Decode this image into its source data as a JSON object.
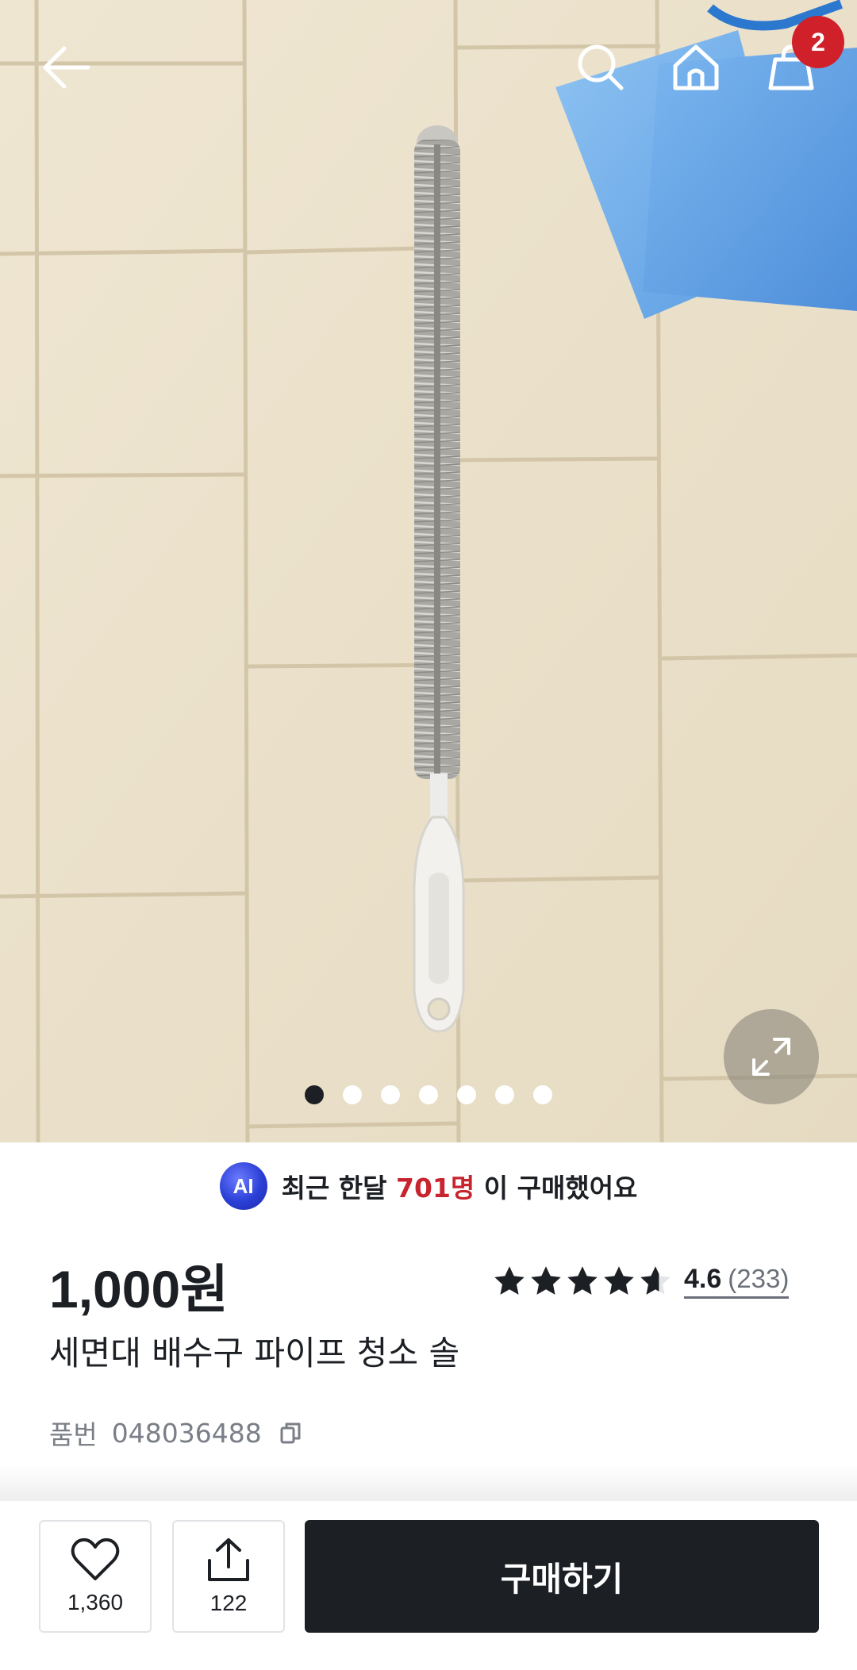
{
  "header": {
    "cart_badge": "2"
  },
  "hero": {
    "image_count": 7,
    "active_index": 0
  },
  "ai_summary": {
    "badge": "AI",
    "prefix": "최근 한달",
    "highlight": "701명",
    "suffix": "이 구매했어요"
  },
  "product": {
    "price": "1,000원",
    "title": "세면대 배수구 파이프 청소 솔",
    "sku_label": "품번",
    "sku": "048036488"
  },
  "rating": {
    "score": "4.6",
    "count": "(233)",
    "value": 4.6,
    "max": 5
  },
  "bottom_bar": {
    "like_count": "1,360",
    "share_count": "122",
    "buy_label": "구매하기"
  },
  "colors": {
    "accent": "#c8242f",
    "badge": "#d0202a",
    "primary_button": "#1c1f24",
    "ai_badge": "#2a3fd6"
  },
  "icons": {
    "back": "arrow-left-icon",
    "search": "search-icon",
    "home": "home-icon",
    "cart": "shopping-bag-icon",
    "expand": "expand-icon",
    "copy": "copy-icon",
    "like": "heart-icon",
    "share": "share-icon"
  }
}
